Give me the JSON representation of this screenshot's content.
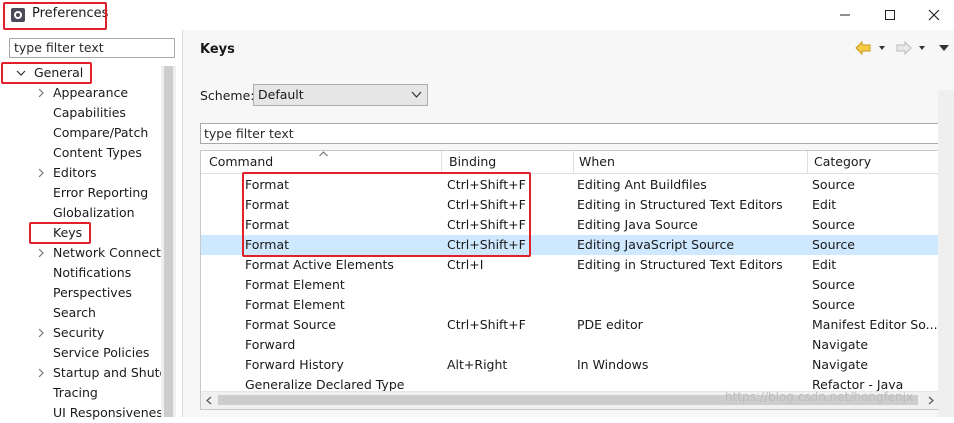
{
  "window": {
    "title": "Preferences"
  },
  "left": {
    "filter_placeholder": "type filter text",
    "tree": [
      {
        "label": "General",
        "expanded": true,
        "level": 0
      },
      {
        "label": "Appearance",
        "level": 1,
        "has_children": true
      },
      {
        "label": "Capabilities",
        "level": 1
      },
      {
        "label": "Compare/Patch",
        "level": 1
      },
      {
        "label": "Content Types",
        "level": 1
      },
      {
        "label": "Editors",
        "level": 1,
        "has_children": true
      },
      {
        "label": "Error Reporting",
        "level": 1
      },
      {
        "label": "Globalization",
        "level": 1
      },
      {
        "label": "Keys",
        "level": 1,
        "selected": true
      },
      {
        "label": "Network Connecti",
        "level": 1,
        "has_children": true
      },
      {
        "label": "Notifications",
        "level": 1
      },
      {
        "label": "Perspectives",
        "level": 1
      },
      {
        "label": "Search",
        "level": 1
      },
      {
        "label": "Security",
        "level": 1,
        "has_children": true
      },
      {
        "label": "Service Policies",
        "level": 1
      },
      {
        "label": "Startup and Shutd",
        "level": 1,
        "has_children": true
      },
      {
        "label": "Tracing",
        "level": 1
      },
      {
        "label": "UI Responsivenes",
        "level": 1
      }
    ]
  },
  "main": {
    "title": "Keys",
    "scheme_label": "Scheme:",
    "scheme_value": "Default",
    "filter_placeholder": "type filter text",
    "columns": [
      "Command",
      "Binding",
      "When",
      "Category"
    ],
    "rows": [
      [
        "Format",
        "Ctrl+Shift+F",
        "Editing Ant Buildfiles",
        "Source"
      ],
      [
        "Format",
        "Ctrl+Shift+F",
        "Editing in Structured Text Editors",
        "Edit"
      ],
      [
        "Format",
        "Ctrl+Shift+F",
        "Editing Java Source",
        "Source"
      ],
      [
        "Format",
        "Ctrl+Shift+F",
        "Editing JavaScript Source",
        "Source"
      ],
      [
        "Format Active Elements",
        "Ctrl+I",
        "Editing in Structured Text Editors",
        "Edit"
      ],
      [
        "Format Element",
        "",
        "",
        "Source"
      ],
      [
        "Format Element",
        "",
        "",
        "Source"
      ],
      [
        "Format Source",
        "Ctrl+Shift+F",
        "PDE editor",
        "Manifest Editor So..."
      ],
      [
        "Forward",
        "",
        "",
        "Navigate"
      ],
      [
        "Forward History",
        "Alt+Right",
        "In Windows",
        "Navigate"
      ],
      [
        "Generalize Declared Type",
        "",
        "",
        "Refactor - Java"
      ]
    ],
    "selected_row": 3
  },
  "watermark": "https://blog.csdn.net/hongfenjx",
  "colors": {
    "highlight": "#e0202a",
    "selection": "#cde8ff"
  }
}
